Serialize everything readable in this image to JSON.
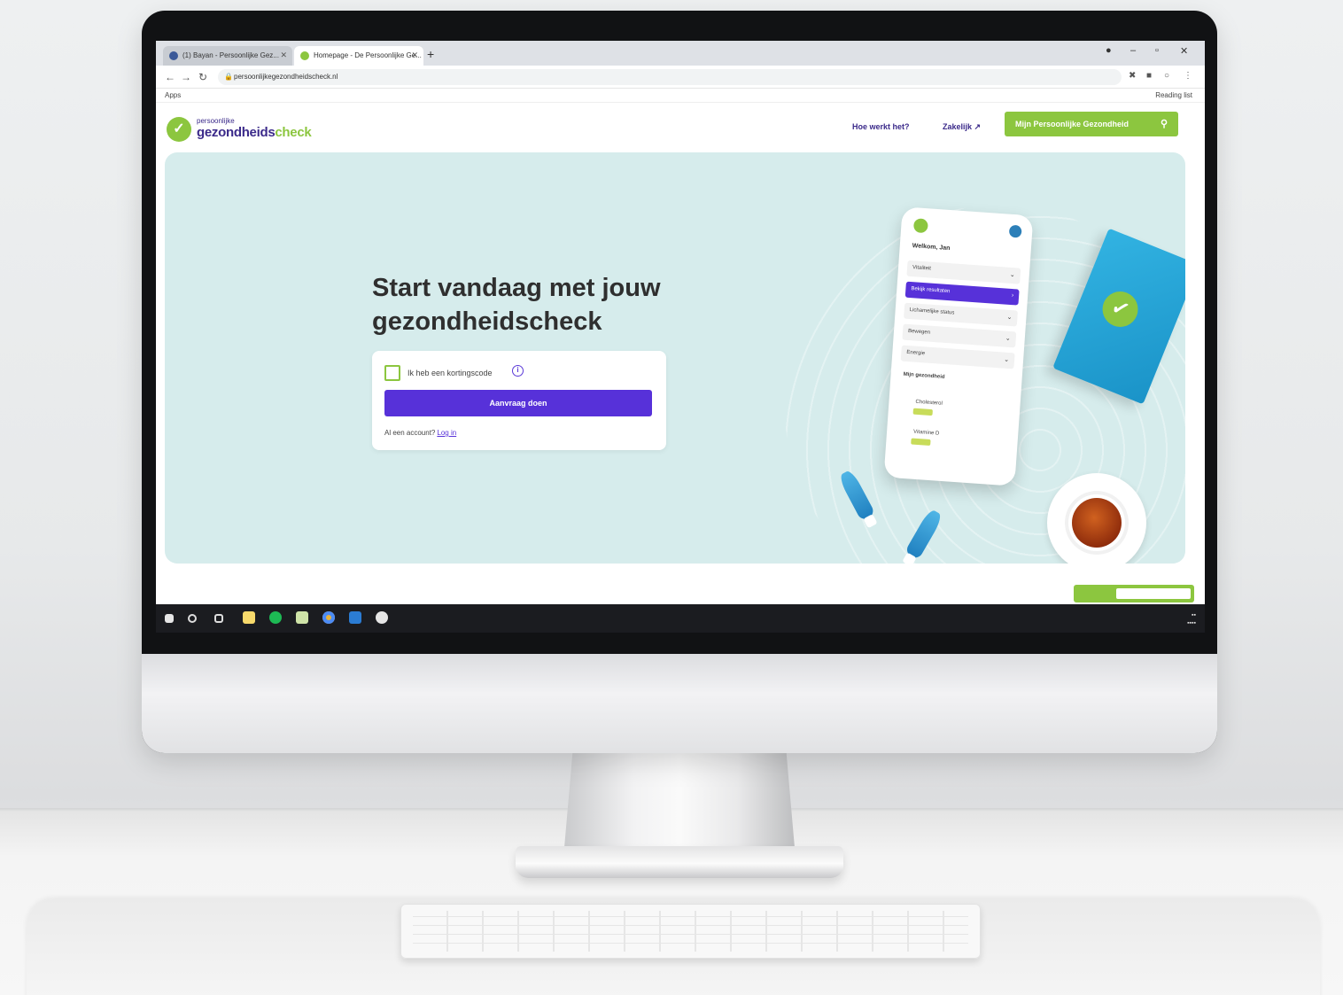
{
  "browser": {
    "tabs": [
      {
        "label": "(1) Bayan - Persoonlijke Gez...",
        "active": false
      },
      {
        "label": "Homepage - De Persoonlijke Ge...",
        "active": true
      }
    ],
    "url": "persoonlijkegezondheidscheck.nl",
    "bookmark": "Apps",
    "reading_list": "Reading list"
  },
  "header": {
    "logo_small": "persoonlijke",
    "logo_main": "gezondheids",
    "logo_accent": "check",
    "nav": [
      "Hoe werkt het?",
      "Zakelijk"
    ],
    "cta_label": "Mijn Persoonlijke Gezondheid"
  },
  "hero": {
    "headline_line1": "Start vandaag met jouw",
    "headline_line2": "gezondheidscheck",
    "checkbox_label": "Ik heb een kortingscode",
    "button_label": "Aanvraag doen",
    "account_text": "Al een account?",
    "login_link": "Log in"
  },
  "phone": {
    "title": "Welkom, Jan",
    "rows": [
      "Vitaliteit",
      "Bekijk resultaten",
      "Lichamelijke status",
      "Bewegen",
      "Energie"
    ],
    "section": "Mijn gezondheid",
    "items": [
      "Cholesterol",
      "Vitamine D"
    ]
  },
  "colors": {
    "brand_green": "#8cc63f",
    "brand_purple": "#5731d9",
    "hero_bg": "#d6ecec"
  }
}
